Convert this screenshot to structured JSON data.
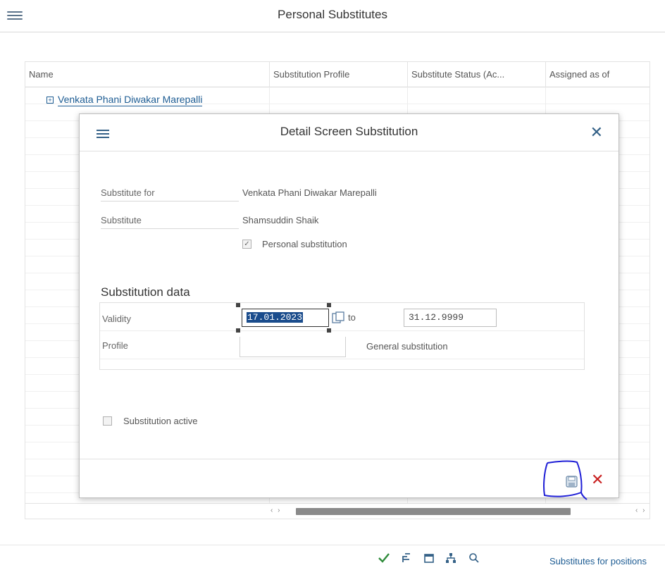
{
  "page": {
    "title": "Personal Substitutes"
  },
  "table": {
    "columns": [
      "Name",
      "Substitution Profile",
      "Substitute Status (Ac...",
      "Assigned as of"
    ],
    "rows": [
      {
        "name": "Venkata Phani Diwakar Marepalli",
        "expand_symbol": "+"
      }
    ]
  },
  "dialog": {
    "title": "Detail Screen Substitution",
    "substitute_for_label": "Substitute for",
    "substitute_for_value": "Venkata Phani Diwakar Marepalli",
    "substitute_label": "Substitute",
    "substitute_value": "Shamsuddin Shaik",
    "personal_substitution_label": "Personal substitution",
    "personal_substitution_checked": true,
    "section_title": "Substitution data",
    "validity_label": "Validity",
    "validity_from": "17.01.2023",
    "to_label": "to",
    "validity_to": "31.12.9999",
    "profile_label": "Profile",
    "profile_value": "",
    "profile_description": "General substitution",
    "substitution_active_label": "Substitution active",
    "substitution_active_checked": false
  },
  "toolbar": {
    "icons": [
      "check-icon",
      "hierarchy-icon",
      "calendar-icon",
      "org-structure-icon",
      "search-icon"
    ],
    "substitutes_for_positions": "Substitutes for positions"
  },
  "colors": {
    "link": "#1d5c93",
    "selection": "#1a4c8c",
    "cancel": "#c92020",
    "confirm": "#2e8b3a",
    "annotation": "#1f1fd6"
  }
}
